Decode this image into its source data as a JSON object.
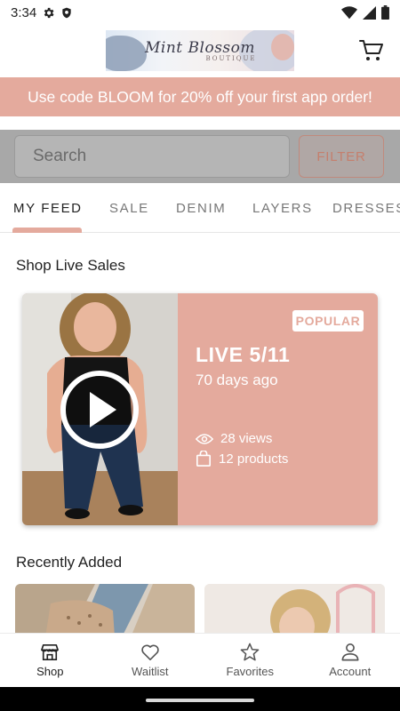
{
  "status_bar": {
    "time": "3:34"
  },
  "header": {
    "logo_script": "Mint Blossom",
    "logo_sub": "BOUTIQUE"
  },
  "promo": {
    "text": "Use code BLOOM for 20% off your first app order!"
  },
  "search": {
    "placeholder": "Search",
    "filter_label": "FILTER"
  },
  "tabs": [
    {
      "label": "MY FEED",
      "active": true
    },
    {
      "label": "SALE"
    },
    {
      "label": "DENIM"
    },
    {
      "label": "LAYERS"
    },
    {
      "label": "DRESSES"
    }
  ],
  "live_section": {
    "title": "Shop Live Sales",
    "card": {
      "badge": "POPULAR",
      "title": "LIVE 5/11",
      "ago": "70 days ago",
      "views": "28 views",
      "products": "12 products"
    }
  },
  "recent_section": {
    "title": "Recently Added"
  },
  "bottom_nav": [
    {
      "label": "Shop",
      "icon": "storefront-icon",
      "active": true
    },
    {
      "label": "Waitlist",
      "icon": "heart-icon"
    },
    {
      "label": "Favorites",
      "icon": "star-icon"
    },
    {
      "label": "Account",
      "icon": "person-icon"
    }
  ],
  "colors": {
    "accent": "#e4aa9d",
    "text": "#222222"
  }
}
